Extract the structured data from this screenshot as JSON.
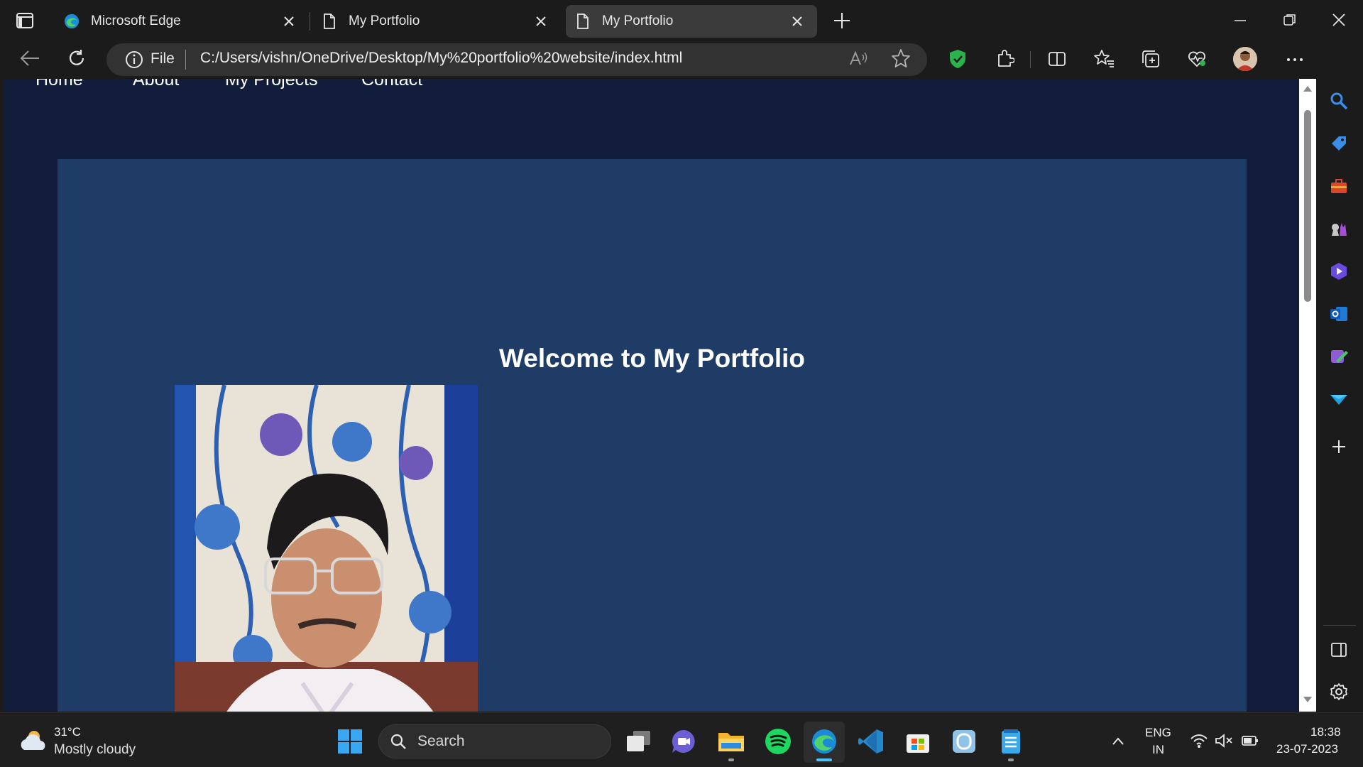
{
  "browser": {
    "tabs": [
      {
        "title": "Microsoft Edge",
        "active": false
      },
      {
        "title": "My Portfolio",
        "active": false
      },
      {
        "title": "My Portfolio",
        "active": true
      }
    ],
    "address": {
      "scheme_label": "File",
      "url": "C:/Users/vishn/OneDrive/Desktop/My%20portfolio%20website/index.html"
    }
  },
  "page": {
    "nav": [
      "Home",
      "About",
      "My Projects",
      "Contact"
    ],
    "hero_title": "Welcome to My Portfolio",
    "colors": {
      "page_bg": "#111d3b",
      "hero_bg": "#1f3c66",
      "text": "#ffffff"
    }
  },
  "sidebar_icons": [
    "search-icon",
    "shopping-tag-icon",
    "tools-icon",
    "games-icon",
    "copilot-icon",
    "outlook-icon",
    "drop-icon",
    "send-icon",
    "add-icon",
    "sidebar-layout-icon",
    "settings-icon"
  ],
  "taskbar": {
    "weather": {
      "temp": "31°C",
      "desc": "Mostly cloudy"
    },
    "search_placeholder": "Search",
    "lang_line1": "ENG",
    "lang_line2": "IN",
    "time": "18:38",
    "date": "23-07-2023"
  }
}
